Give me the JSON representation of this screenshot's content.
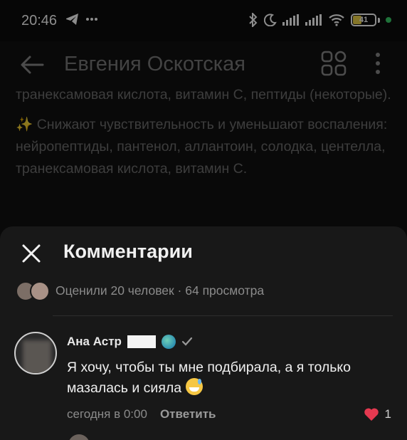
{
  "status_bar": {
    "time": "20:46",
    "icons_left": [
      "telegram-icon",
      "more-dots"
    ],
    "icons_right": [
      "bluetooth-icon",
      "moon-icon",
      "signal-icon",
      "signal-icon",
      "wifi-icon",
      "battery-icon"
    ],
    "battery_level": "41"
  },
  "app_bar": {
    "title": "Евгения Оскотская"
  },
  "background_post": {
    "lines": [
      "транексамовая кислота, витамин С, пептиды (некоторые).",
      "✨ Снижают чувствительность и уменьшают воспаления: нейропептиды, пантенол, аллантоин, солодка, центелла, транексамовая кислота, витамин С."
    ]
  },
  "comments_sheet": {
    "title": "Комментарии",
    "stats": "Оценили 20 человек · 64 просмотра",
    "comment": {
      "author": "Ана Астр",
      "text": "Я хочу, чтобы ты мне подбирала, а я только мазалась и сияла",
      "time": "сегодня в 0:00",
      "reply_label": "Ответить",
      "likes": "1"
    }
  },
  "colors": {
    "background": "#121212",
    "sheet": "#181818",
    "heart": "#e53950",
    "muted_text": "#8b8b8b"
  }
}
